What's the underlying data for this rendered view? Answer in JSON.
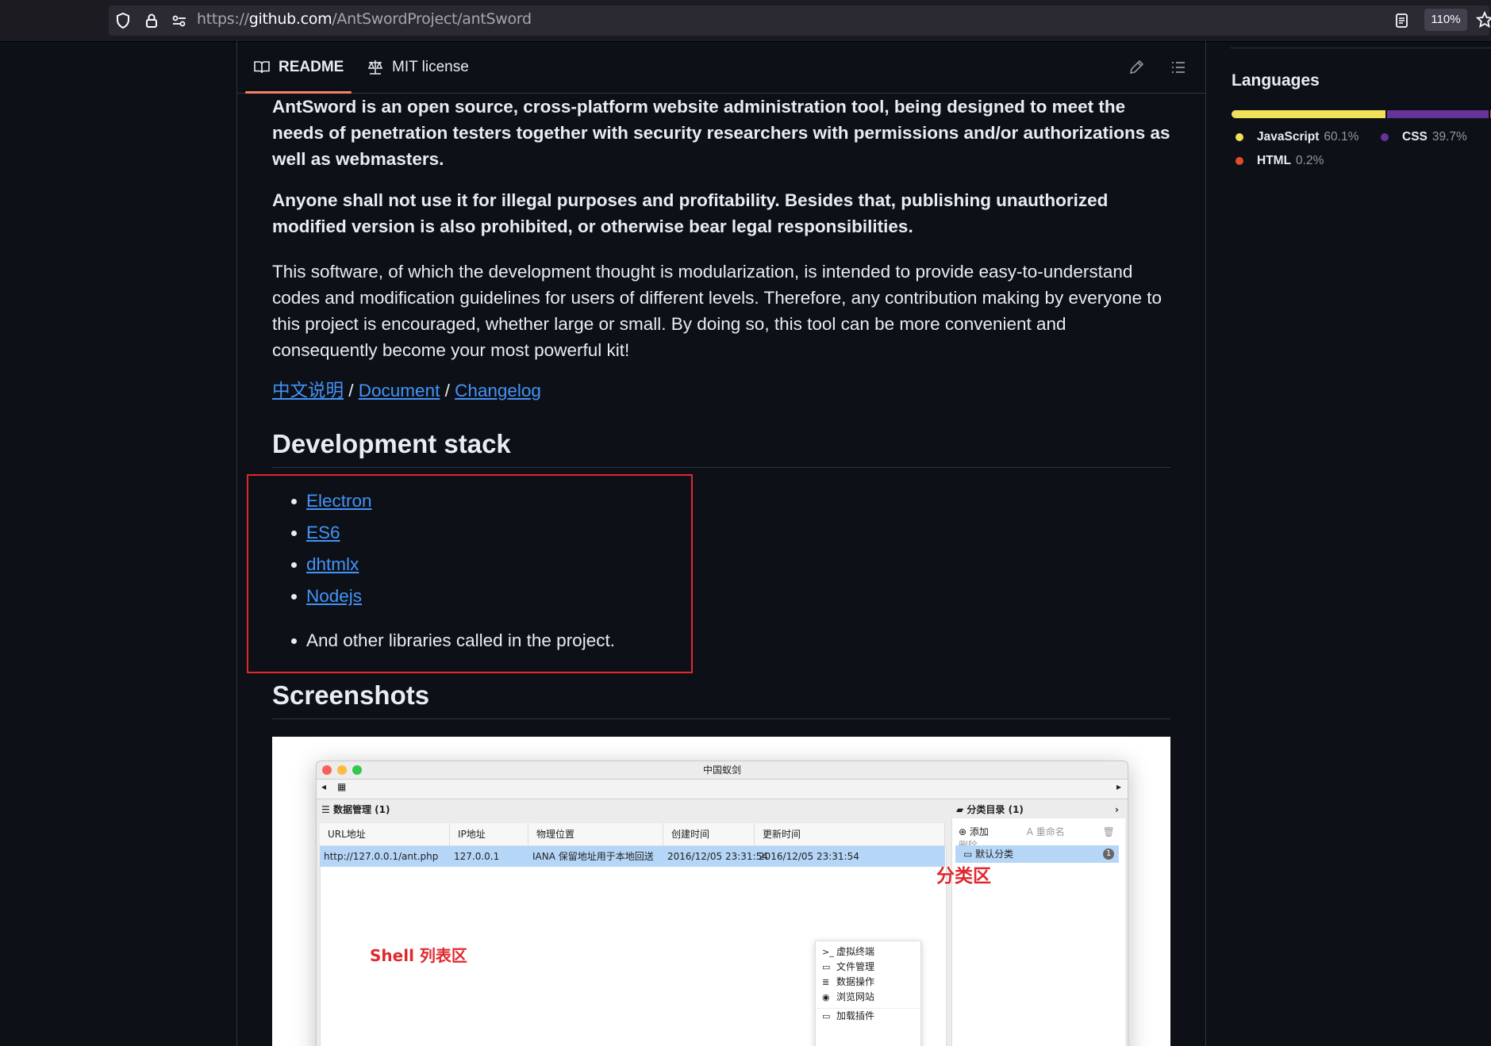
{
  "browser": {
    "url_prefix": "https://",
    "url_host": "github.com",
    "url_path": "/AntSwordProject/antSword",
    "zoom": "110%"
  },
  "readme_tabs": {
    "readme": "README",
    "license": "MIT license"
  },
  "content": {
    "para1": "AntSword is an open source, cross-platform website administration tool, being designed to meet the needs of penetration testers together with security researchers with permissions and/or authorizations as well as webmasters.",
    "para2": "Anyone shall not use it for illegal purposes and profitability. Besides that, publishing unauthorized modified version is also prohibited, or otherwise bear legal responsibilities.",
    "para3": "This software, of which the development thought is modularization, is intended to provide easy-to-understand codes and modification guidelines for users of different levels. Therefore, any contribution making by everyone to this project is encouraged, whether large or small. By doing so, this tool can be more convenient and consequently become your most powerful kit!",
    "links": [
      "中文说明",
      "Document",
      "Changelog"
    ],
    "link_separator": " / ",
    "dev_stack_heading": "Development stack",
    "stack_items": [
      "Electron",
      "ES6",
      "dhtmlx",
      "Nodejs"
    ],
    "stack_extra": "And other libraries called in the project.",
    "screenshots_heading": "Screenshots"
  },
  "screenshot": {
    "window_title": "中国蚁剑",
    "data_panel_title": "数据管理 (1)",
    "category_panel_title": "分类目录 (1)",
    "columns": [
      "URL地址",
      "IP地址",
      "物理位置",
      "创建时间",
      "更新时间"
    ],
    "row": [
      "http://127.0.0.1/ant.php",
      "127.0.0.1",
      "IANA 保留地址用于本地回送",
      "2016/12/05 23:31:54",
      "2016/12/05 23:31:54"
    ],
    "cat_tools": [
      "添加",
      "重命名",
      "删除"
    ],
    "cat_default": "默认分类",
    "cat_count": "1",
    "annotation_category": "分类区",
    "annotation_shell": "Shell 列表区",
    "context_menu": [
      "虚拟终端",
      "文件管理",
      "数据操作",
      "浏览网站",
      "加载插件"
    ]
  },
  "languages": {
    "title": "Languages",
    "items": [
      {
        "name": "JavaScript",
        "pct": "60.1%",
        "color": "#f1e05a"
      },
      {
        "name": "CSS",
        "pct": "39.7%",
        "color": "#663399"
      },
      {
        "name": "HTML",
        "pct": "0.2%",
        "color": "#e34c26"
      }
    ]
  },
  "colors": {
    "link": "#4493f8",
    "annotation_red": "#e0282e",
    "tab_underline": "#f78166"
  }
}
